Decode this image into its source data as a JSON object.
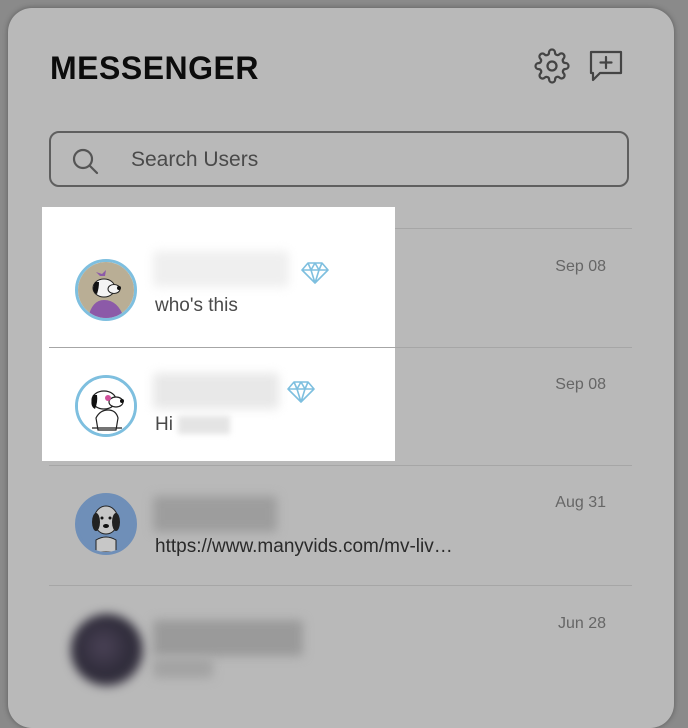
{
  "app": {
    "title": "MESSENGER",
    "icons": {
      "settings": "gear-icon",
      "compose": "new-message-icon"
    }
  },
  "search": {
    "placeholder": "Search Users",
    "icon": "search-icon"
  },
  "colors": {
    "accent": "#7ebfdf",
    "overlay_panel": "#b9b9b9",
    "highlight": "#ffffff"
  },
  "conversations": [
    {
      "preview": "who's this",
      "date": "Sep 08",
      "premium": true,
      "highlighted": true,
      "name_hidden": true
    },
    {
      "preview": "Hi ",
      "date": "Sep 08",
      "premium": true,
      "highlighted": true,
      "name_hidden": true
    },
    {
      "preview": "https://www.manyvids.com/mv-liv…",
      "date": "Aug 31",
      "premium": false,
      "highlighted": false,
      "name_hidden": true
    },
    {
      "preview": "",
      "date": "Jun 28",
      "premium": false,
      "highlighted": false,
      "name_hidden": true
    }
  ]
}
